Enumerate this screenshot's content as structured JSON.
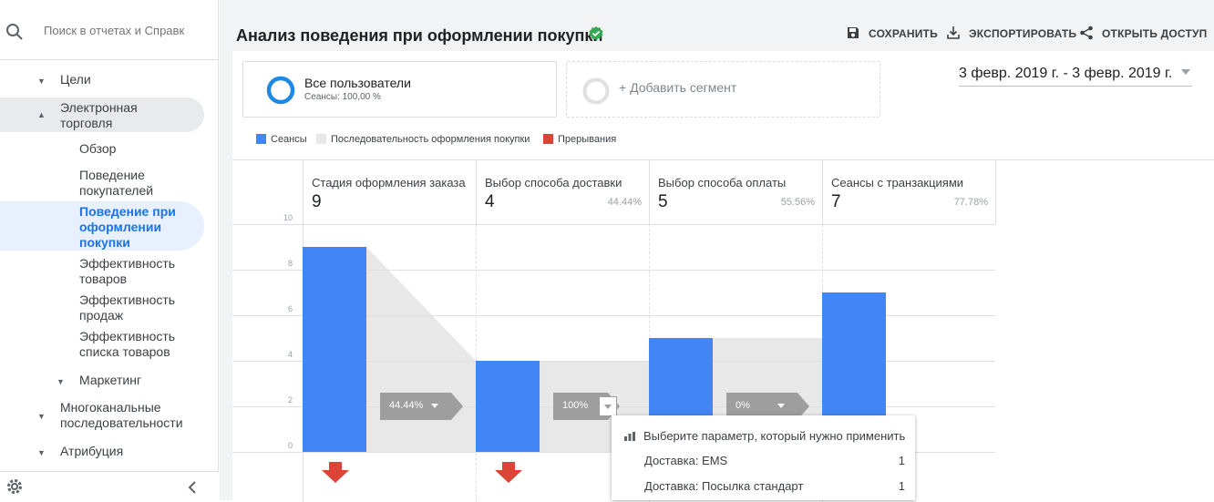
{
  "sidebar": {
    "search_placeholder": "Поиск в отчетах и Справк",
    "items": {
      "goals": "Цели",
      "ecommerce": "Электронная торговля",
      "overview": "Обзор",
      "shopping_behavior": "Поведение покупателей",
      "checkout_behavior": "Поведение при оформлении покупки",
      "product_performance": "Эффективность товаров",
      "sales_performance": "Эффективность продаж",
      "product_list_performance": "Эффективность списка товаров",
      "marketing": "Маркетинг",
      "multichannel": "Многоканальные последовательности",
      "attribution": "Атрибуция"
    }
  },
  "header": {
    "title": "Анализ поведения при оформлении покупки",
    "save": "СОХРАНИТЬ",
    "export": "ЭКСПОРТИРОВАТЬ",
    "share": "ОТКРЫТЬ ДОСТУП"
  },
  "segments": {
    "all_users": "Все пользователи",
    "all_users_sub": "Сеансы: 100,00 %",
    "add_segment": "+ Добавить сегмент"
  },
  "date_range": "3 февр. 2019 г. - 3 февр. 2019 г.",
  "legend": {
    "sessions": "Сеансы",
    "funnel": "Последовательность оформления покупки",
    "abandon": "Прерывания"
  },
  "colors": {
    "sessions": "#4285f4",
    "funnel": "#e8e8e8",
    "abandon": "#db4437",
    "verified": "#34a853"
  },
  "chart_data": {
    "type": "bar",
    "categories": [
      "Стадия оформления заказа",
      "Выбор способа доставки",
      "Выбор способа оплаты",
      "Сеансы с транзакциями"
    ],
    "values": [
      9,
      4,
      5,
      7
    ],
    "stage_pct": [
      "",
      "44.44%",
      "55.56%",
      "77.78%"
    ],
    "conversion": [
      "44.44%",
      "100%",
      "0%"
    ],
    "y_ticks": [
      "10",
      "8",
      "6",
      "4",
      "2",
      "0"
    ],
    "ylim": [
      0,
      10
    ]
  },
  "dropdown": {
    "header": "Выберите параметр, который нужно применить",
    "rows": [
      {
        "label": "Доставка: EMS",
        "count": "1"
      },
      {
        "label": "Доставка: Посылка стандарт",
        "count": "1"
      }
    ]
  }
}
